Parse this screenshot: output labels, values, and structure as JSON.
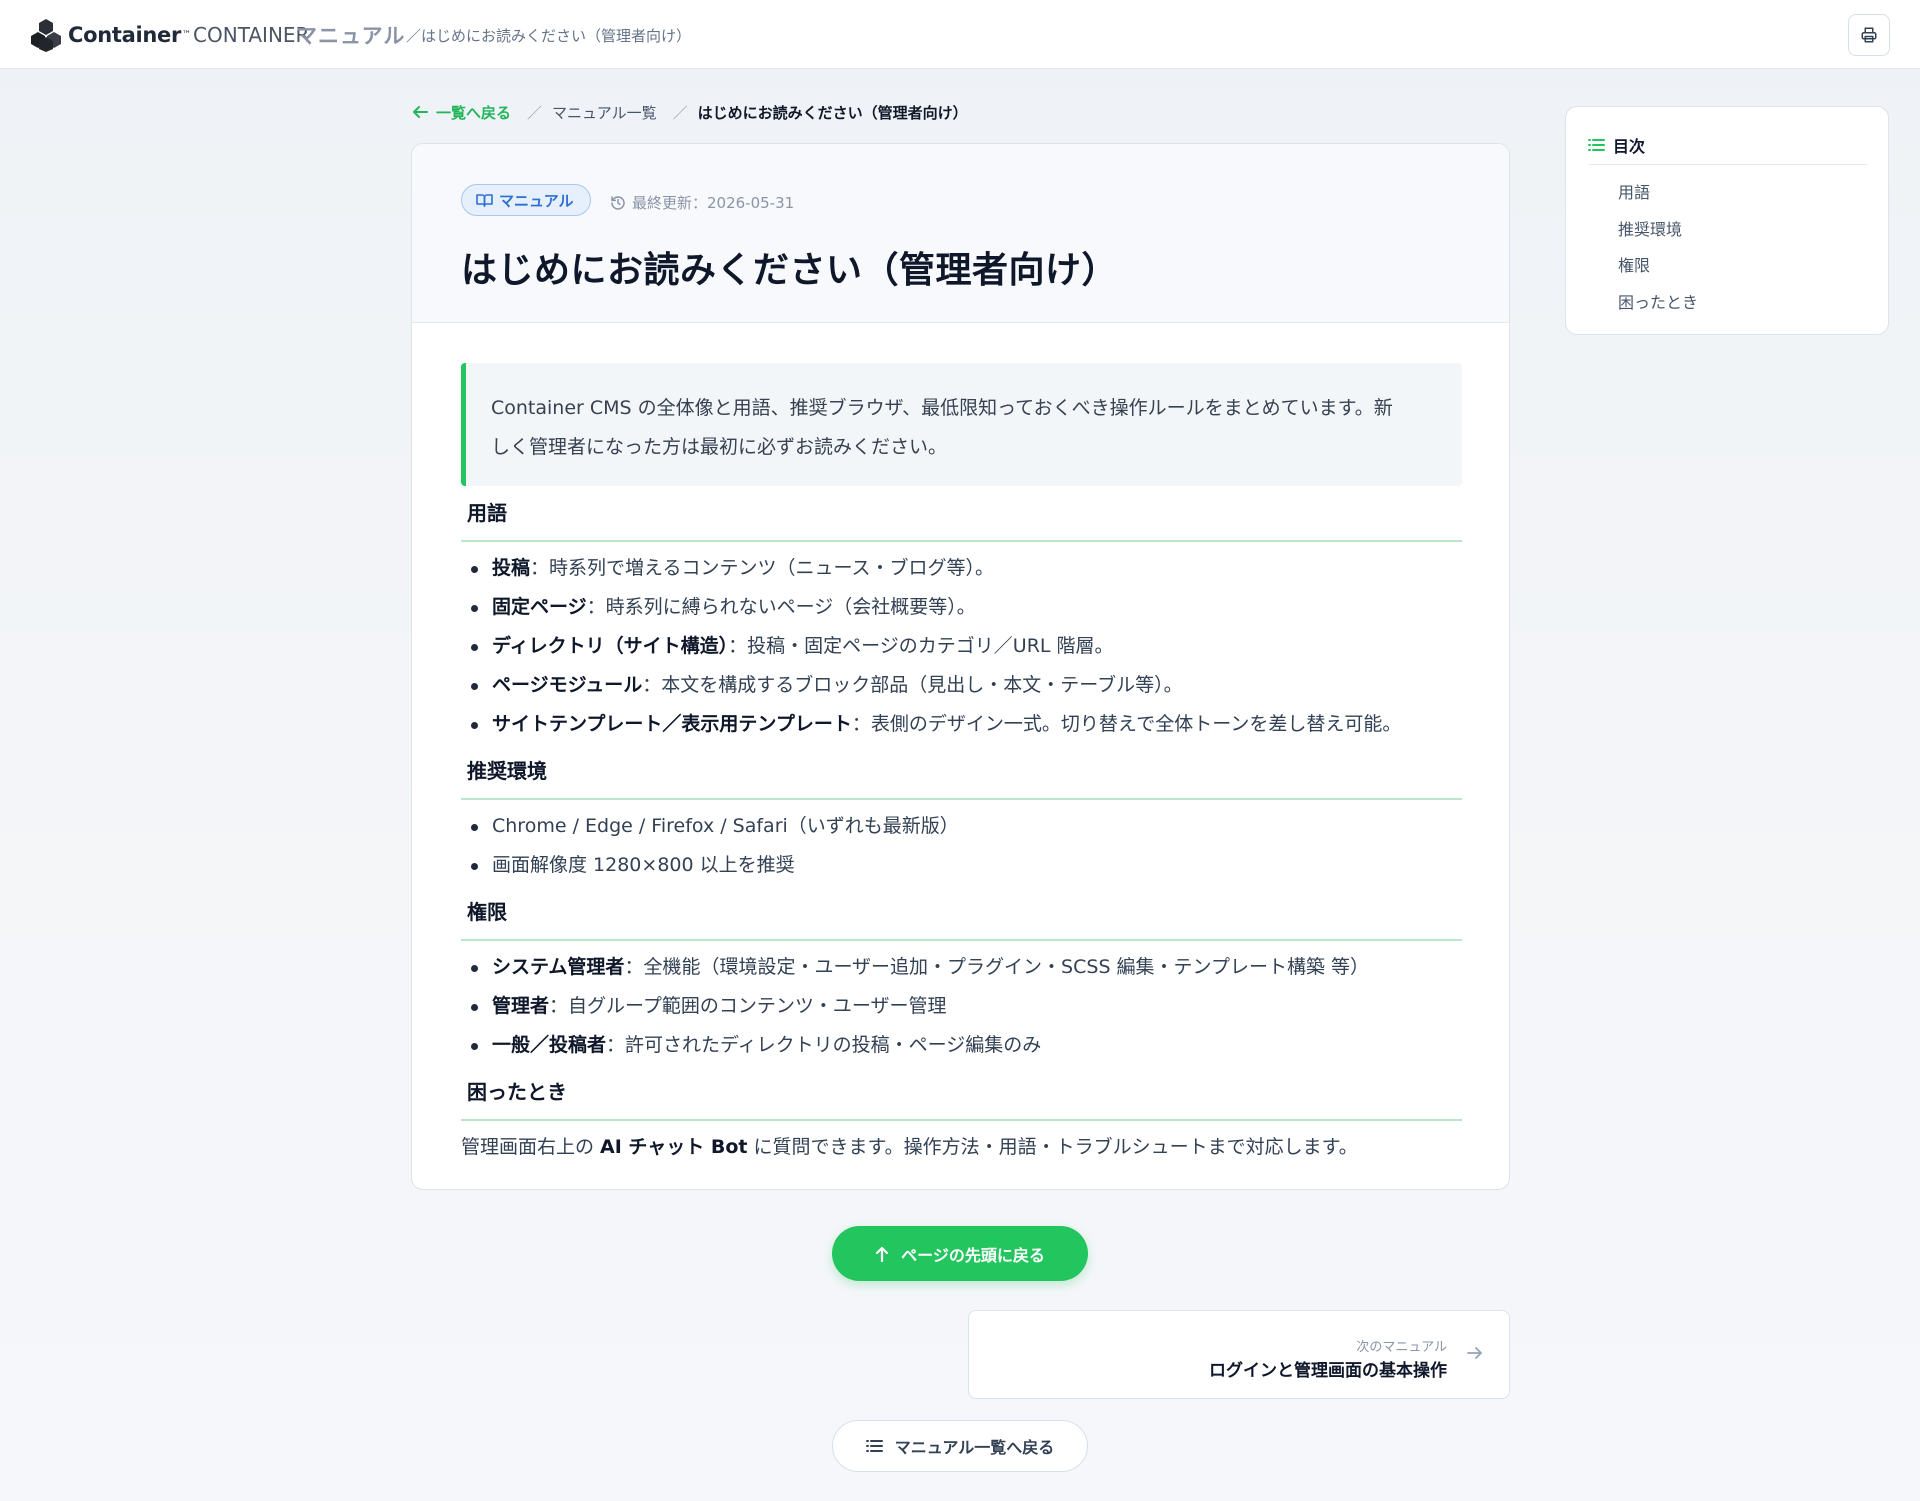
{
  "header": {
    "brand_name": "Container",
    "brand_tm": "™",
    "brand_sub": "CONTAINER",
    "section": "マニュアル",
    "crumb": "／はじめにお読みください（管理者向け）"
  },
  "breadcrumb": {
    "back": "一覧へ戻る",
    "sep": "／",
    "list": "マニュアル一覧",
    "current": "はじめにお読みください（管理者向け）"
  },
  "article": {
    "tag": "マニュアル",
    "updated": "最終更新：2026-05-31",
    "title": "はじめにお読みください（管理者向け）",
    "intro_line1": "Container CMS の全体像と用語、推奨ブラウザ、最低限知っておくべき操作ルールをまとめています。新",
    "intro_line2": "しく管理者になった方は最初に必ずお読みください。",
    "sections": {
      "terms": {
        "heading": "用語",
        "items": [
          {
            "term": "投稿",
            "desc": "：時系列で増えるコンテンツ（ニュース・ブログ等）。"
          },
          {
            "term": "固定ページ",
            "desc": "：時系列に縛られないページ（会社概要等）。"
          },
          {
            "term": "ディレクトリ（サイト構造）",
            "desc": "：投稿・固定ページのカテゴリ／URL 階層。"
          },
          {
            "term": "ページモジュール",
            "desc": "：本文を構成するブロック部品（見出し・本文・テーブル等）。"
          },
          {
            "term": "サイトテンプレート／表示用テンプレート",
            "desc": "：表側のデザイン一式。切り替えで全体トーンを差し替え可能。"
          }
        ]
      },
      "env": {
        "heading": "推奨環境",
        "items": [
          "Chrome / Edge / Firefox / Safari（いずれも最新版）",
          "画面解像度 1280×800 以上を推奨"
        ]
      },
      "perm": {
        "heading": "権限",
        "items": [
          {
            "term": "システム管理者",
            "desc": "：全機能（環境設定・ユーザー追加・プラグイン・SCSS 編集・テンプレート構築 等）"
          },
          {
            "term": "管理者",
            "desc": "：自グループ範囲のコンテンツ・ユーザー管理"
          },
          {
            "term": "一般／投稿者",
            "desc": "：許可されたディレクトリの投稿・ページ編集のみ"
          }
        ]
      },
      "help": {
        "heading": "困ったとき",
        "text_before": "管理画面右上の ",
        "text_bold": "AI チャット Bot",
        "text_after": " に質問できます。操作方法・用語・トラブルシュートまで対応します。"
      }
    }
  },
  "toc": {
    "title": "目次",
    "items": [
      "用語",
      "推奨環境",
      "権限",
      "困ったとき"
    ]
  },
  "footer_nav": {
    "to_top": "ページの先頭に戻る",
    "next_label": "次のマニュアル",
    "next_title": "ログインと管理画面の基本操作",
    "back_to_list": "マニュアル一覧へ戻る"
  },
  "colors": {
    "accent": "#22c55e",
    "tag_blue": "#2f6fcf",
    "heading_border": "#b8e7c9"
  },
  "icons": [
    "cube-logo-icon",
    "printer-icon",
    "arrow-left-icon",
    "book-icon",
    "history-icon",
    "list-icon",
    "arrow-up-icon",
    "arrow-right-icon"
  ]
}
